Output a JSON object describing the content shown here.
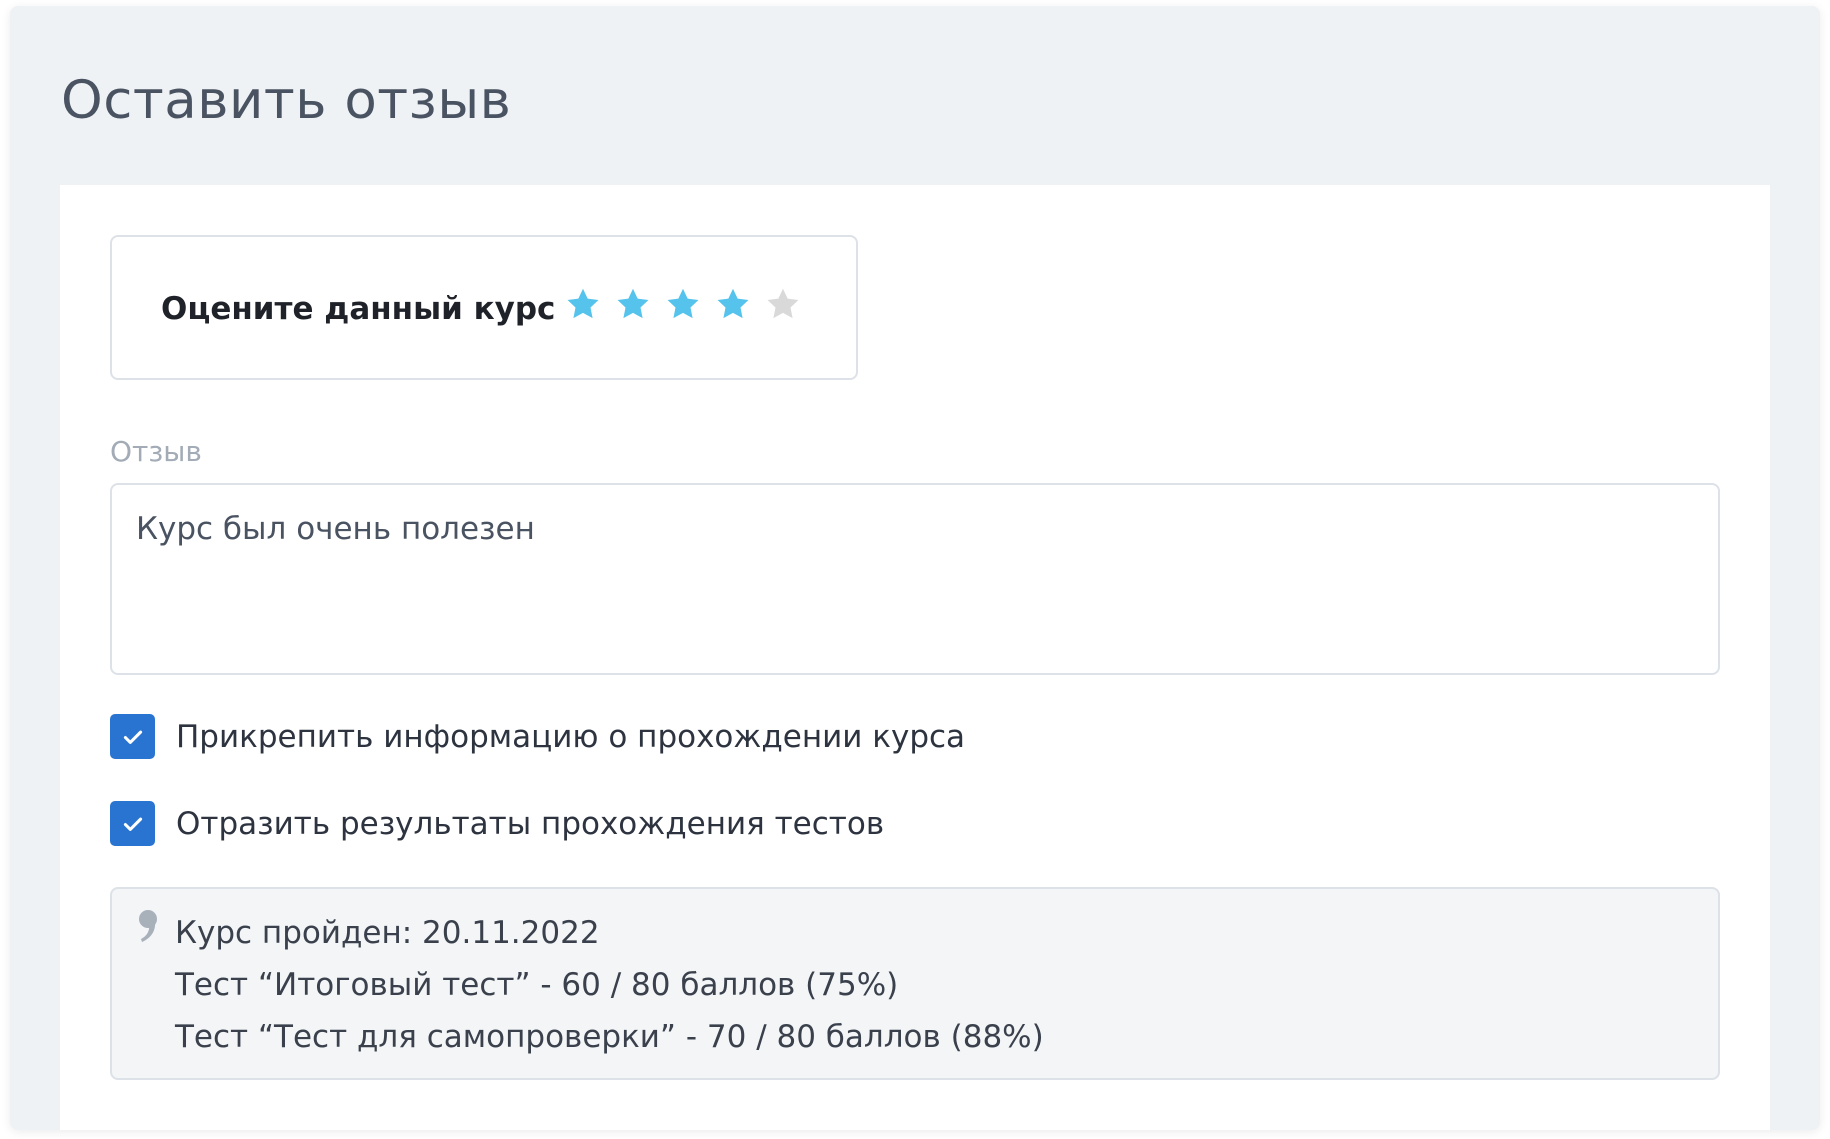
{
  "page": {
    "title": "Оставить отзыв"
  },
  "rating": {
    "label": "Оцените данный курс",
    "value": 4,
    "max": 5,
    "filled_color": "#55c3ec",
    "empty_color": "#d9d9d9"
  },
  "review": {
    "label": "Отзыв",
    "value": "Курс был очень полезен"
  },
  "options": [
    {
      "label": "Прикрепить информацию о прохождении курса",
      "checked": true
    },
    {
      "label": "Отразить результаты прохождения тестов",
      "checked": true
    }
  ],
  "summary": {
    "icon": "quote-icon",
    "lines": [
      "Курс пройден: 20.11.2022",
      "Тест “Итоговый тест” - 60 / 80 баллов (75%)",
      "Тест “Тест для самопроверки” - 70 / 80 баллов (88%)"
    ]
  },
  "colors": {
    "accent": "#2a74d1",
    "background": "#eff2f5",
    "border": "#dde2e8"
  }
}
